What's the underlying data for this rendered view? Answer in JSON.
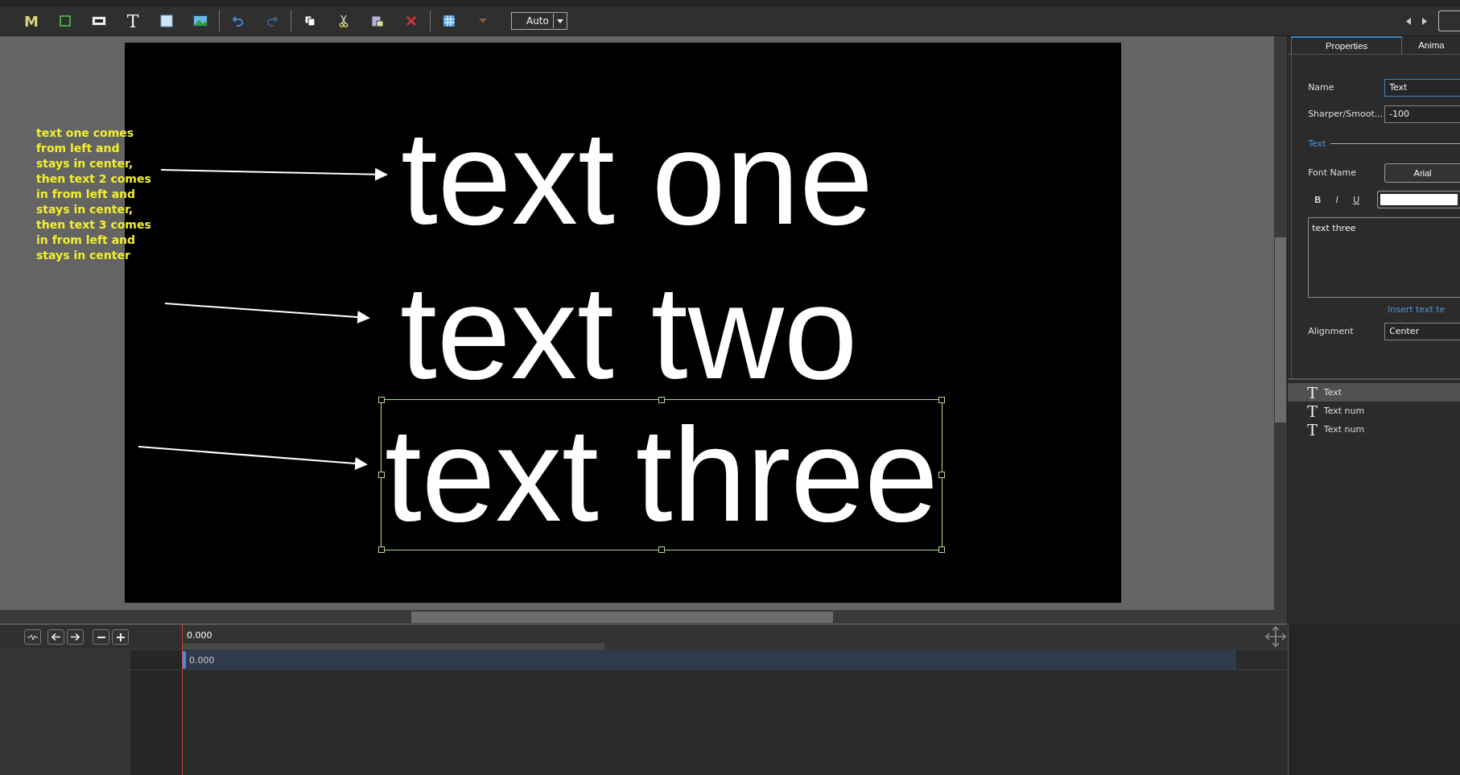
{
  "toolbar": {
    "tools": [
      {
        "kind": "letter",
        "label": "M"
      },
      {
        "kind": "frame"
      },
      {
        "kind": "ok-button"
      },
      {
        "kind": "letter",
        "label": "T"
      },
      {
        "kind": "rectangle"
      },
      {
        "kind": "image"
      },
      {
        "kind": "separator"
      },
      {
        "kind": "undo"
      },
      {
        "kind": "redo"
      },
      {
        "kind": "separator"
      },
      {
        "kind": "copy"
      },
      {
        "kind": "cut"
      },
      {
        "kind": "paste"
      },
      {
        "kind": "delete"
      },
      {
        "kind": "separator"
      },
      {
        "kind": "grid"
      },
      {
        "kind": "dropdown-caret"
      }
    ],
    "zoom_select": {
      "value": "Auto"
    }
  },
  "slide": {
    "texts": [
      {
        "text": "text one",
        "selected": false
      },
      {
        "text": "text two",
        "selected": false
      },
      {
        "text": "text three",
        "selected": true
      }
    ]
  },
  "annotation": {
    "text": "text one comes from left and stays in center, then text 2 comes in from left and stays in center, then text 3 comes in from left and stays in center"
  },
  "properties_panel": {
    "tabs": [
      {
        "label": "Properties",
        "selected": true
      },
      {
        "label": "Anima",
        "selected": false
      }
    ],
    "name": {
      "label": "Name",
      "value": "Text"
    },
    "sharpness": {
      "label": "Sharper/Smoot...",
      "value": "-100"
    },
    "section": "Text",
    "font": {
      "label": "Font Name",
      "value": "Arial"
    },
    "styles": [
      {
        "label": "B",
        "kind": "bold"
      },
      {
        "label": "I",
        "kind": "italic"
      },
      {
        "label": "U",
        "kind": "underline"
      }
    ],
    "text_value": "text three",
    "insert_link": "Insert text te",
    "alignment": {
      "label": "Alignment",
      "value": "Center"
    },
    "objects": [
      {
        "icon": "T",
        "label": "Text",
        "selected": true
      },
      {
        "icon": "T",
        "label": "Text num",
        "selected": false
      },
      {
        "icon": "T",
        "label": "Text num",
        "selected": false
      }
    ]
  },
  "timeline": {
    "ruler_time": "0.000",
    "track_time": "0.000"
  }
}
